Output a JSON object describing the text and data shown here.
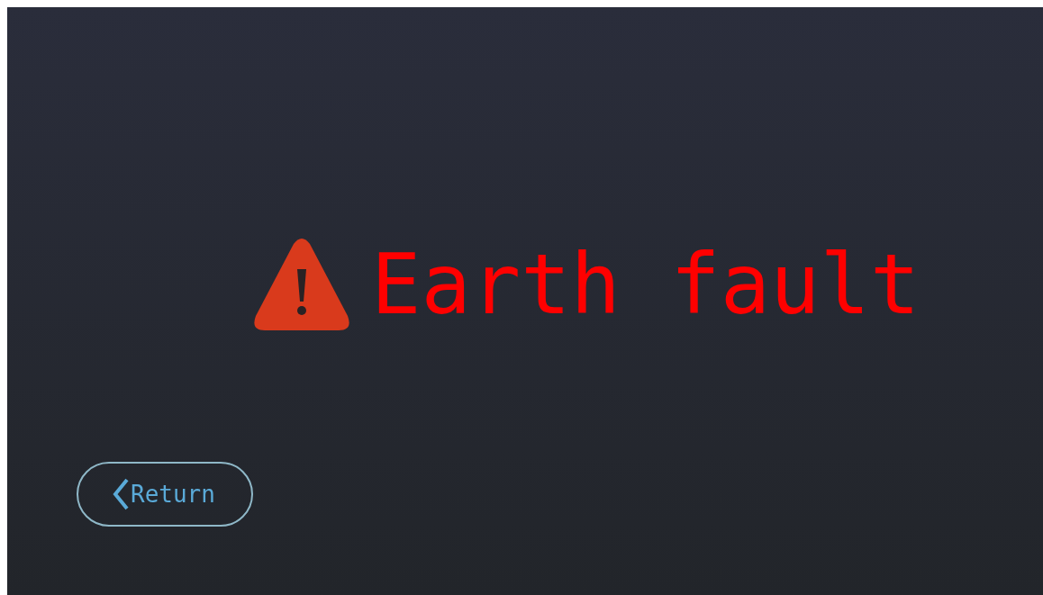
{
  "alarm": {
    "message": "Earth fault"
  },
  "return_button": {
    "label": "Return"
  }
}
